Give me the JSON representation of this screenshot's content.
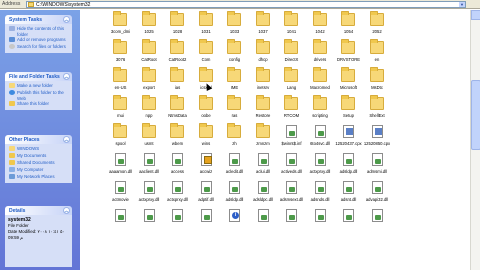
{
  "address": {
    "label": "Address",
    "path": "C:\\WINDOWS\\system32"
  },
  "system_tasks": {
    "title": "System Tasks",
    "items": [
      {
        "label": "Hide the contents of this folder",
        "line2": "folder",
        "text": "Hide the contents of this"
      },
      {
        "label": "Add or remove programs"
      },
      {
        "label": "Search for files or folders"
      }
    ]
  },
  "file_folder_tasks": {
    "title": "File and Folder Tasks",
    "items": [
      {
        "label": "Make a new folder"
      },
      {
        "label": "Publish this folder to the",
        "line2": "Web"
      },
      {
        "label": "Share this folder"
      }
    ]
  },
  "other_places": {
    "title": "Other Places",
    "items": [
      {
        "label": "WINDOWS"
      },
      {
        "label": "My Documents"
      },
      {
        "label": "Shared Documents"
      },
      {
        "label": "My Computer"
      },
      {
        "label": "My Network Places"
      }
    ]
  },
  "details": {
    "title": "Details",
    "name": "system32",
    "type": "File Folder",
    "modified": "Date Modified: ٥٠ ١٠:٤١ ٢٠٠٨",
    "modified2": "09:59 م"
  },
  "files": [
    {
      "name": "3com_dmi",
      "type": "folder"
    },
    {
      "name": "1025",
      "type": "folder"
    },
    {
      "name": "1028",
      "type": "folder"
    },
    {
      "name": "1031",
      "type": "folder"
    },
    {
      "name": "1033",
      "type": "folder"
    },
    {
      "name": "1037",
      "type": "folder"
    },
    {
      "name": "1041",
      "type": "folder"
    },
    {
      "name": "1042",
      "type": "folder"
    },
    {
      "name": "1054",
      "type": "folder"
    },
    {
      "name": "2052",
      "type": "folder"
    },
    {
      "name": "",
      "type": "none"
    },
    {
      "name": "",
      "type": "none"
    },
    {
      "name": "",
      "type": "none"
    },
    {
      "name": "",
      "type": "none"
    },
    {
      "name": "3076",
      "type": "folder"
    },
    {
      "name": "CatRoot",
      "type": "folder"
    },
    {
      "name": "CatRoot2",
      "type": "folder"
    },
    {
      "name": "Com",
      "type": "folder"
    },
    {
      "name": "config",
      "type": "folder"
    },
    {
      "name": "dhcp",
      "type": "folder"
    },
    {
      "name": "DirectX",
      "type": "folder"
    },
    {
      "name": "drivers",
      "type": "folder"
    },
    {
      "name": "DRVSTORE",
      "type": "folder"
    },
    {
      "name": "en",
      "type": "folder"
    },
    {
      "name": "",
      "type": "none"
    },
    {
      "name": "",
      "type": "none"
    },
    {
      "name": "",
      "type": "none"
    },
    {
      "name": "",
      "type": "none"
    },
    {
      "name": "en-US",
      "type": "folder"
    },
    {
      "name": "export",
      "type": "folder"
    },
    {
      "name": "ias",
      "type": "folder"
    },
    {
      "name": "icsxml",
      "type": "folder"
    },
    {
      "name": "IME",
      "type": "folder"
    },
    {
      "name": "inetsrv",
      "type": "folder"
    },
    {
      "name": "Lang",
      "type": "folder"
    },
    {
      "name": "Macromed",
      "type": "folder"
    },
    {
      "name": "Microsoft",
      "type": "folder"
    },
    {
      "name": "MsDtc",
      "type": "folder"
    },
    {
      "name": "",
      "type": "none"
    },
    {
      "name": "",
      "type": "none"
    },
    {
      "name": "",
      "type": "none"
    },
    {
      "name": "",
      "type": "none"
    },
    {
      "name": "mui",
      "type": "folder"
    },
    {
      "name": "npp",
      "type": "folder"
    },
    {
      "name": "NtmsData",
      "type": "folder"
    },
    {
      "name": "oobe",
      "type": "folder"
    },
    {
      "name": "ras",
      "type": "folder"
    },
    {
      "name": "Restore",
      "type": "folder"
    },
    {
      "name": "RTCOM",
      "type": "folder"
    },
    {
      "name": "scripting",
      "type": "folder"
    },
    {
      "name": "Setup",
      "type": "folder"
    },
    {
      "name": "ShellExt",
      "type": "folder"
    },
    {
      "name": "",
      "type": "none"
    },
    {
      "name": "",
      "type": "none"
    },
    {
      "name": "",
      "type": "none"
    },
    {
      "name": "",
      "type": "none"
    },
    {
      "name": "spool",
      "type": "folder"
    },
    {
      "name": "usmt",
      "type": "folder"
    },
    {
      "name": "wbem",
      "type": "folder"
    },
    {
      "name": "wins",
      "type": "folder"
    },
    {
      "name": "zh",
      "type": "folder"
    },
    {
      "name": "zmnzm",
      "type": "folder"
    },
    {
      "name": "$winnt$.inf",
      "type": "file"
    },
    {
      "name": "6to4svc.dll",
      "type": "file"
    },
    {
      "name": "12520437.cpx",
      "type": "cpx"
    },
    {
      "name": "12520850.cpx",
      "type": "cpx"
    },
    {
      "name": "",
      "type": "none"
    },
    {
      "name": "",
      "type": "none"
    },
    {
      "name": "",
      "type": "none"
    },
    {
      "name": "",
      "type": "none"
    },
    {
      "name": "aaaamon.dll",
      "type": "file"
    },
    {
      "name": "aaclient.dll",
      "type": "file"
    },
    {
      "name": "access",
      "type": "file"
    },
    {
      "name": "accwiz",
      "type": "exe"
    },
    {
      "name": "acledit.dll",
      "type": "file"
    },
    {
      "name": "aclui.dll",
      "type": "file"
    },
    {
      "name": "activeds.dll",
      "type": "file"
    },
    {
      "name": "actxprxy.dll",
      "type": "file"
    },
    {
      "name": "adsldp.dll",
      "type": "file"
    },
    {
      "name": "admsmi.dll",
      "type": "file"
    },
    {
      "name": "",
      "type": "none"
    },
    {
      "name": "",
      "type": "none"
    },
    {
      "name": "",
      "type": "none"
    },
    {
      "name": "",
      "type": "none"
    },
    {
      "name": "actmovie",
      "type": "file"
    },
    {
      "name": "actxprxy.dll",
      "type": "file"
    },
    {
      "name": "actxprxy.dll",
      "type": "file"
    },
    {
      "name": "adptif.dll",
      "type": "file"
    },
    {
      "name": "adsldp.dll",
      "type": "file"
    },
    {
      "name": "adsldpc.dll",
      "type": "file"
    },
    {
      "name": "adsmsext.dll",
      "type": "file"
    },
    {
      "name": "adsnds.dll",
      "type": "file"
    },
    {
      "name": "adsnt.dll",
      "type": "file"
    },
    {
      "name": "advapi32.dll",
      "type": "file"
    },
    {
      "name": "",
      "type": "none"
    },
    {
      "name": "",
      "type": "none"
    },
    {
      "name": "",
      "type": "none"
    },
    {
      "name": "",
      "type": "none"
    },
    {
      "name": "",
      "type": "file"
    },
    {
      "name": "",
      "type": "file"
    },
    {
      "name": "",
      "type": "file"
    },
    {
      "name": "",
      "type": "file"
    },
    {
      "name": "",
      "type": "info"
    },
    {
      "name": "",
      "type": "file"
    },
    {
      "name": "",
      "type": "file"
    },
    {
      "name": "",
      "type": "file"
    },
    {
      "name": "",
      "type": "file"
    },
    {
      "name": "",
      "type": "file"
    },
    {
      "name": "",
      "type": "none"
    },
    {
      "name": "",
      "type": "none"
    },
    {
      "name": "",
      "type": "none"
    },
    {
      "name": "",
      "type": "none"
    }
  ]
}
